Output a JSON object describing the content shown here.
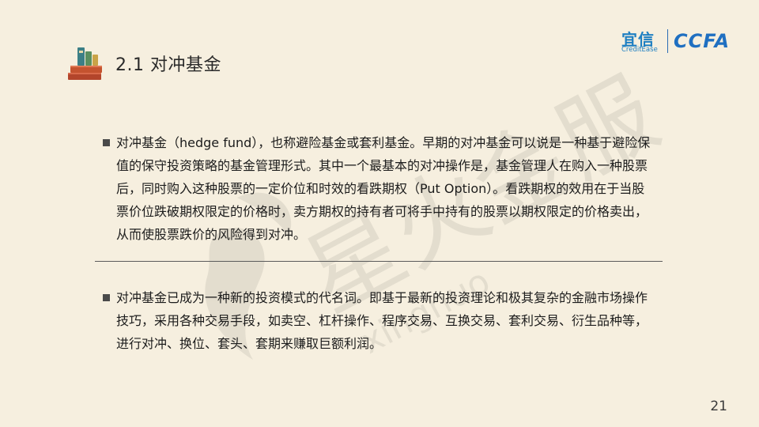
{
  "title": "2.1 对冲基金",
  "logo": {
    "brand_cn": "宜信",
    "brand_en": "CreditEase",
    "partner": "CCFA"
  },
  "paragraphs": [
    "对冲基金（hedge fund），也称避险基金或套利基金。早期的对冲基金可以说是一种基于避险保值的保守投资策略的基金管理形式。其中一个最基本的对冲操作是，基金管理人在购入一种股票后，同时购入这种股票的一定价位和时效的看跌期权（Put Option）。看跌期权的效用在于当股票价位跌破期权限定的价格时，卖方期权的持有者可将手中持有的股票以期权限定的价格卖出，从而使股票跌价的风险得到对冲。",
    "对冲基金已成为一种新的投资模式的代名词。即基于最新的投资理论和极其复杂的金融市场操作技巧，采用各种交易手段，如卖空、杠杆操作、程序交易、互换交易、套利交易、衍生品种等，进行对冲、换位、套头、套期来赚取巨额利润。"
  ],
  "watermark": {
    "text_cn": "星火金服",
    "text_en": "xinghuo"
  },
  "page_number": "21",
  "colors": {
    "background": "#f6efdf",
    "brand_blue": "#1e7fc2",
    "bullet": "#4a4a4a",
    "books_red": "#b3452b",
    "books_teal": "#3c7f86"
  }
}
